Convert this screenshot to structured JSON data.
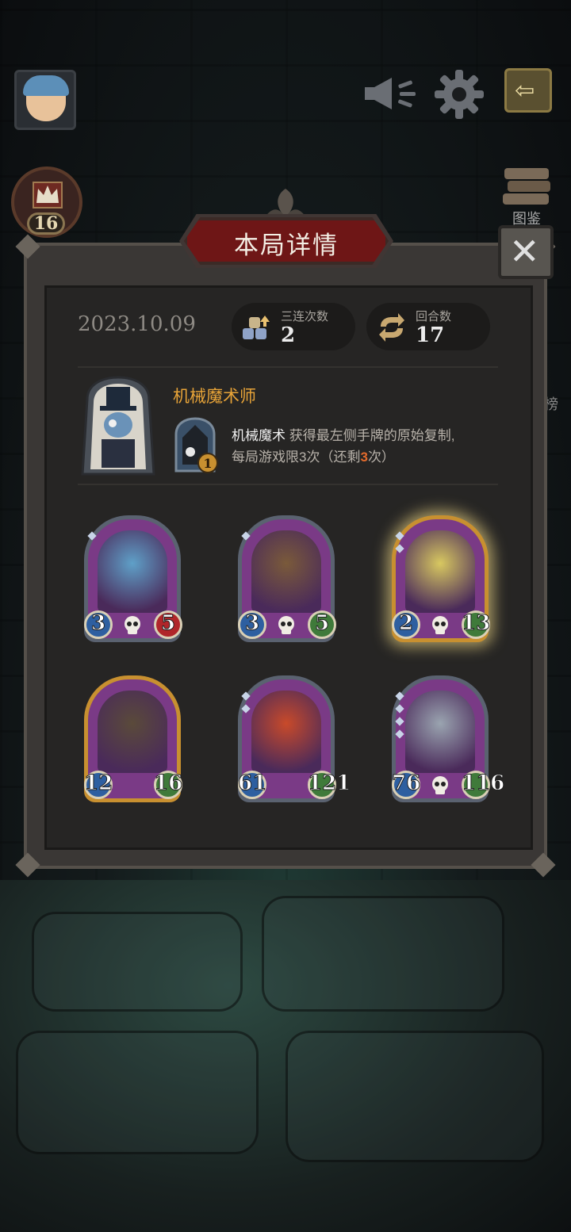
{
  "title": "本局详情",
  "date": "2023.10.09",
  "stats": [
    {
      "label": "三连次数",
      "value": "2",
      "icon": "triple-cube-icon"
    },
    {
      "label": "回合数",
      "value": "17",
      "icon": "cycle-arrows-icon"
    }
  ],
  "hero": {
    "name": "机械魔术师",
    "skill_name": "机械魔术",
    "skill_desc_1": " 获得最左侧手牌的原始复制,",
    "skill_desc_2": "每局游戏限3次（还剩",
    "skill_remaining": "3",
    "skill_desc_3": "次）",
    "skill_level": "1"
  },
  "top_bar": {
    "rank": "16",
    "side_label": "图鉴",
    "side_label_2": "榜"
  },
  "cards": [
    {
      "attack": "3",
      "health": "5",
      "health_style": "red",
      "frame": "silver",
      "pips": 1,
      "skull": true
    },
    {
      "attack": "3",
      "health": "5",
      "health_style": "green",
      "frame": "silver",
      "pips": 1,
      "skull": true
    },
    {
      "attack": "2",
      "health": "13",
      "health_style": "green",
      "frame": "gold",
      "pips": 2,
      "skull": true
    },
    {
      "attack": "12",
      "health": "16",
      "health_style": "green",
      "frame": "gold",
      "pips": 0,
      "skull": false
    },
    {
      "attack": "61",
      "health": "121",
      "health_style": "green",
      "frame": "silver",
      "pips": 2,
      "skull": false
    },
    {
      "attack": "76",
      "health": "116",
      "health_style": "green",
      "frame": "silver",
      "pips": 4,
      "skull": true
    }
  ],
  "colors": {
    "title_plate": "#6e1616",
    "hero_name": "#e8a438",
    "highlight": "#e26a2c"
  }
}
